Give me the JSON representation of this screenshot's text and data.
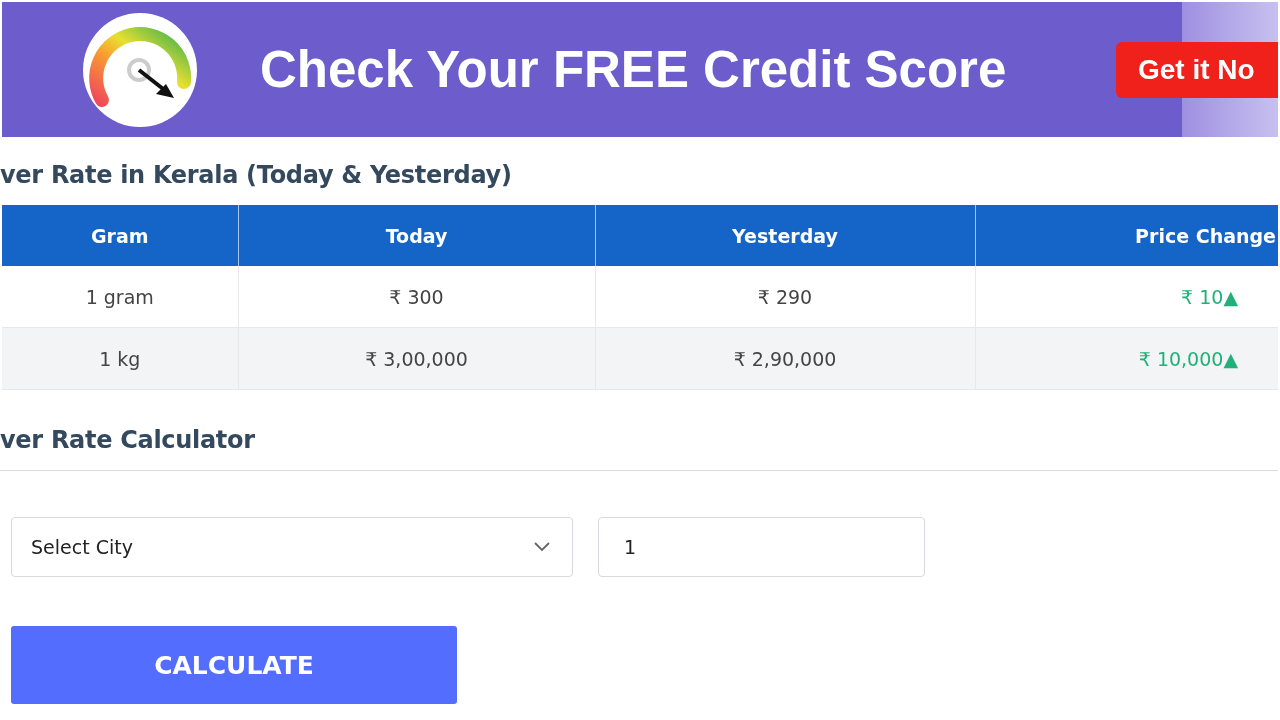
{
  "banner": {
    "headline": "Check Your FREE Credit Score",
    "button": "Get it No"
  },
  "table": {
    "title": "ver Rate in Kerala (Today & Yesterday)",
    "columns": [
      "Gram",
      "Today",
      "Yesterday",
      "Price Change"
    ],
    "rows": [
      {
        "cells": [
          "1 gram",
          "₹ 300",
          "₹ 290",
          "₹ 10▲"
        ]
      },
      {
        "cells": [
          "1 kg",
          "₹ 3,00,000",
          "₹ 2,90,000",
          "₹ 10,000▲"
        ]
      }
    ]
  },
  "calculator": {
    "title": "ver Rate Calculator",
    "city_select": {
      "value": "Select City"
    },
    "quantity": {
      "value": "1"
    },
    "button": "CALCULATE"
  }
}
